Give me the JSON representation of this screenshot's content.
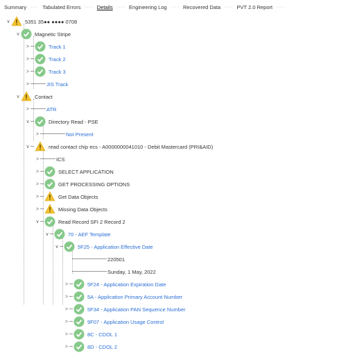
{
  "tabs": [
    {
      "label": "Summary",
      "active": false
    },
    {
      "label": "Tabulated Errors",
      "active": false
    },
    {
      "label": "Details",
      "active": true
    },
    {
      "label": "Engineering Log",
      "active": false
    },
    {
      "label": "Recovered Data",
      "active": false
    },
    {
      "label": "PVT 2.0 Report",
      "active": false
    }
  ],
  "tab_separator": "····",
  "colors": {
    "ok": "#86c98a",
    "warning": "#f2c230",
    "link": "#2a6fd6"
  },
  "tree": [
    {
      "label": "5351 35●● ●●●● 0708",
      "icon": "warning-icon",
      "chevron": "∨",
      "style": "plain"
    },
    {
      "label": "Magnetic Stripe",
      "icon": "checkmark-icon",
      "chevron": "∨",
      "style": "plain"
    },
    {
      "label": "Track 1",
      "icon": "checkmark-icon",
      "chevron": ">",
      "style": "link"
    },
    {
      "label": "Track 2",
      "icon": "checkmark-icon",
      "chevron": ">",
      "style": "link"
    },
    {
      "label": "Track 3",
      "icon": "checkmark-icon",
      "chevron": ">",
      "style": "link"
    },
    {
      "label": "JIS Track",
      "icon": "",
      "chevron": ">",
      "style": "link"
    },
    {
      "label": "Contact",
      "icon": "warning-icon",
      "chevron": "∨",
      "style": "plain"
    },
    {
      "label": "ATR",
      "icon": "",
      "chevron": ">",
      "style": "link"
    },
    {
      "label": "Directory Read - PSE",
      "icon": "checkmark-icon",
      "chevron": "∨",
      "style": "plain"
    },
    {
      "label": "Not Present",
      "icon": "",
      "chevron": ">",
      "style": "link"
    },
    {
      "label": "read contact chip ecs - A0000000041010 - Debit Mastercard (PRI&AID)",
      "icon": "warning-icon",
      "chevron": "∨",
      "style": "plain"
    },
    {
      "label": "ICS",
      "icon": "",
      "chevron": ">",
      "style": "plain"
    },
    {
      "label": "SELECT APPLICATION",
      "icon": "checkmark-icon",
      "chevron": ">",
      "style": "plain"
    },
    {
      "label": "GET PROCESSING OPTIONS",
      "icon": "checkmark-icon",
      "chevron": ">",
      "style": "plain"
    },
    {
      "label": "Get Data Objects",
      "icon": "warning-icon",
      "chevron": ">",
      "style": "plain"
    },
    {
      "label": "Missing Data Objects",
      "icon": "warning-icon",
      "chevron": ">",
      "style": "plain"
    },
    {
      "label": "Read Record SFI 2 Record 2",
      "icon": "checkmark-icon",
      "chevron": "∨",
      "style": "plain"
    },
    {
      "label": "70 - AEF Template",
      "icon": "checkmark-icon",
      "chevron": "∨",
      "style": "link"
    },
    {
      "label": "5F25 - Application Effective Date",
      "icon": "checkmark-icon",
      "chevron": "∨",
      "style": "link"
    },
    {
      "label": "220501",
      "icon": "",
      "chevron": "",
      "style": "plain"
    },
    {
      "label": "Sunday, 1 May, 2022",
      "icon": "",
      "chevron": "",
      "style": "plain"
    },
    {
      "label": "5F24 - Application Expiration Date",
      "icon": "checkmark-icon",
      "chevron": ">",
      "style": "link"
    },
    {
      "label": "5A - Application Primary Account Number",
      "icon": "checkmark-icon",
      "chevron": ">",
      "style": "link"
    },
    {
      "label": "5F34 - Application PAN Sequence Number",
      "icon": "checkmark-icon",
      "chevron": ">",
      "style": "link"
    },
    {
      "label": "9F07 - Application Usage Control",
      "icon": "checkmark-icon",
      "chevron": ">",
      "style": "link"
    },
    {
      "label": "8C - CDOL 1",
      "icon": "checkmark-icon",
      "chevron": ">",
      "style": "link"
    },
    {
      "label": "8D - CDOL 2",
      "icon": "checkmark-icon",
      "chevron": ">",
      "style": "link"
    }
  ]
}
